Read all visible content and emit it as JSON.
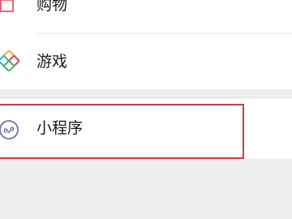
{
  "menu": {
    "shopping": {
      "label": "购物",
      "icon": "shopping-bag-icon"
    },
    "games": {
      "label": "游戏",
      "icon": "games-diamond-icon"
    },
    "mini_programs": {
      "label": "小程序",
      "icon": "mini-program-icon"
    }
  },
  "colors": {
    "background": "#ededed",
    "row": "#ffffff",
    "highlight_border": "#d0393b",
    "shopping_icon": "#e8546b",
    "mini_program_icon": "#6b6fb5"
  }
}
